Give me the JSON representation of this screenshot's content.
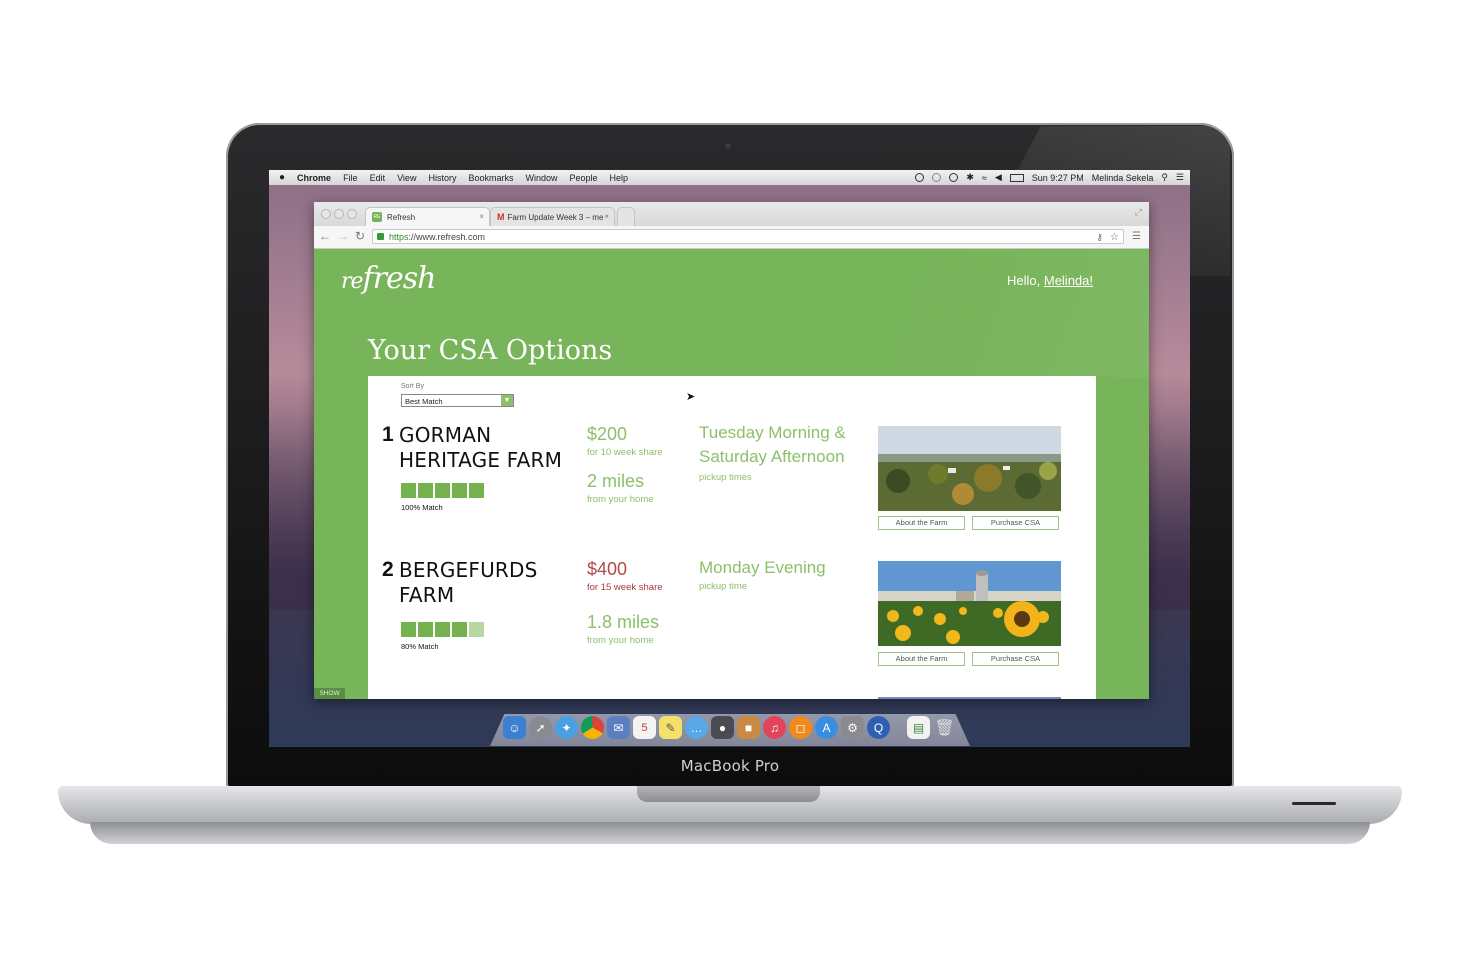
{
  "device": {
    "label": "MacBook Pro"
  },
  "menubar": {
    "app": "Chrome",
    "items": [
      "File",
      "Edit",
      "View",
      "History",
      "Bookmarks",
      "Window",
      "People",
      "Help"
    ],
    "clock": "Sun 9:27 PM",
    "user": "Melinda Sekela"
  },
  "browser": {
    "tabs": [
      {
        "title": "Refresh",
        "favicon": "refresh-favicon"
      },
      {
        "title": "Farm Update Week 3 – me",
        "favicon": "gmail-icon"
      }
    ],
    "url_scheme": "https",
    "url_rest": "://www.refresh.com"
  },
  "page": {
    "logo_re": "re",
    "logo_fresh": "fresh",
    "greeting": "Hello, ",
    "user_name": "Melinda!",
    "title": "Your CSA Options",
    "sort_label": "Sort By",
    "sort_value": "Best Match",
    "show_label": "SHOW",
    "accent_color": "#78b45a",
    "farms": [
      {
        "rank": "1",
        "name": "GORMAN HERITAGE FARM",
        "match_level": 5,
        "match_text": "100% Match",
        "price": "$200",
        "price_sub": "for 10 week share",
        "distance": "2 miles",
        "distance_sub": "from your home",
        "pickup": "Tuesday Morning & Saturday Afternoon",
        "pickup_sub": "pickup times",
        "about_button": "About the Farm",
        "purchase_button": "Purchase CSA"
      },
      {
        "rank": "2",
        "name": "BERGEFURDS FARM",
        "match_level": 4,
        "match_text": "80% Match",
        "price": "$400",
        "price_sub": "for 15 week share",
        "distance": "1.8 miles",
        "distance_sub": "from your home",
        "pickup": "Monday Evening",
        "pickup_sub": "pickup time",
        "about_button": "About the Farm",
        "purchase_button": "Purchase CSA"
      }
    ]
  }
}
